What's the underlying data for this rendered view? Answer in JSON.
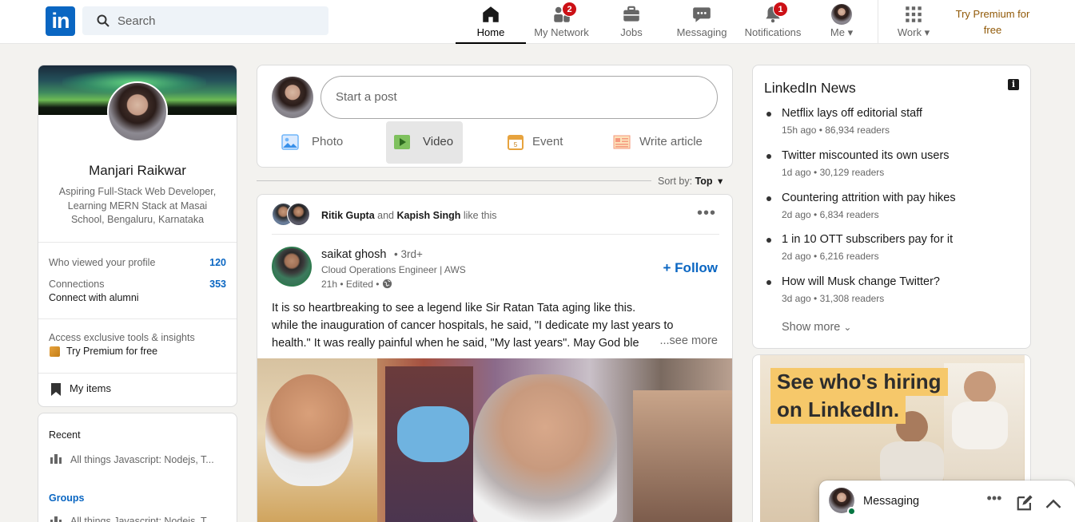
{
  "nav": {
    "search_placeholder": "Search",
    "items": [
      {
        "label": "Home"
      },
      {
        "label": "My Network",
        "badge": "2"
      },
      {
        "label": "Jobs"
      },
      {
        "label": "Messaging"
      },
      {
        "label": "Notifications",
        "badge": "1"
      },
      {
        "label": "Me"
      },
      {
        "label": "Work"
      }
    ],
    "premium": "Try Premium for free"
  },
  "profile": {
    "name": "Manjari Raikwar",
    "headline": "Aspiring Full-Stack Web Developer, Learning MERN Stack at Masai School, Bengaluru, Karnataka",
    "viewed_label": "Who viewed your profile",
    "viewed_value": "120",
    "connections_label": "Connections",
    "connections_value": "353",
    "connect_alumni": "Connect with alumni",
    "premium_note": "Access exclusive tools & insights",
    "premium_cta": "Try Premium for free",
    "my_items": "My items"
  },
  "recent": {
    "heading": "Recent",
    "item": "All things Javascript: Nodejs, T...",
    "groups": "Groups",
    "group_item": "All things Javascript: Nodejs, T..."
  },
  "composer": {
    "placeholder": "Start a post",
    "actions": [
      {
        "label": "Photo",
        "icon": "photo-icon"
      },
      {
        "label": "Video",
        "icon": "video-icon"
      },
      {
        "label": "Event",
        "icon": "event-icon"
      },
      {
        "label": "Write article",
        "icon": "article-icon"
      }
    ]
  },
  "sort": {
    "label": "Sort by:",
    "value": "Top"
  },
  "post": {
    "liker1": "Ritik Gupta",
    "and": "and",
    "liker2": "Kapish Singh",
    "like_this": "like this",
    "author": "saikat ghosh",
    "degree": "• 3rd+",
    "author_title": "Cloud Operations Engineer | AWS",
    "time": "21h • Edited •",
    "follow": "Follow",
    "text1": "It is so heartbreaking to see a legend like Sir Ratan Tata aging like this.",
    "text2": "while the inauguration of cancer hospitals, he said, \"I dedicate my last years to",
    "text3": "health.\" It was really painful when he said, \"My last years\". May God ble",
    "see_more": "...see more"
  },
  "news": {
    "title": "LinkedIn News",
    "items": [
      {
        "title": "Netflix lays off editorial staff",
        "meta": "15h ago • 86,934 readers"
      },
      {
        "title": "Twitter miscounted its own users",
        "meta": "1d ago • 30,129 readers"
      },
      {
        "title": "Countering attrition with pay hikes",
        "meta": "2d ago • 6,834 readers"
      },
      {
        "title": "1 in 10 OTT subscribers pay for it",
        "meta": "2d ago • 6,216 readers"
      },
      {
        "title": "How will Musk change Twitter?",
        "meta": "3d ago • 31,308 readers"
      }
    ],
    "show_more": "Show more"
  },
  "ad": {
    "line1": "See who's hiring",
    "line2": "on LinkedIn."
  },
  "messaging": {
    "label": "Messaging"
  }
}
